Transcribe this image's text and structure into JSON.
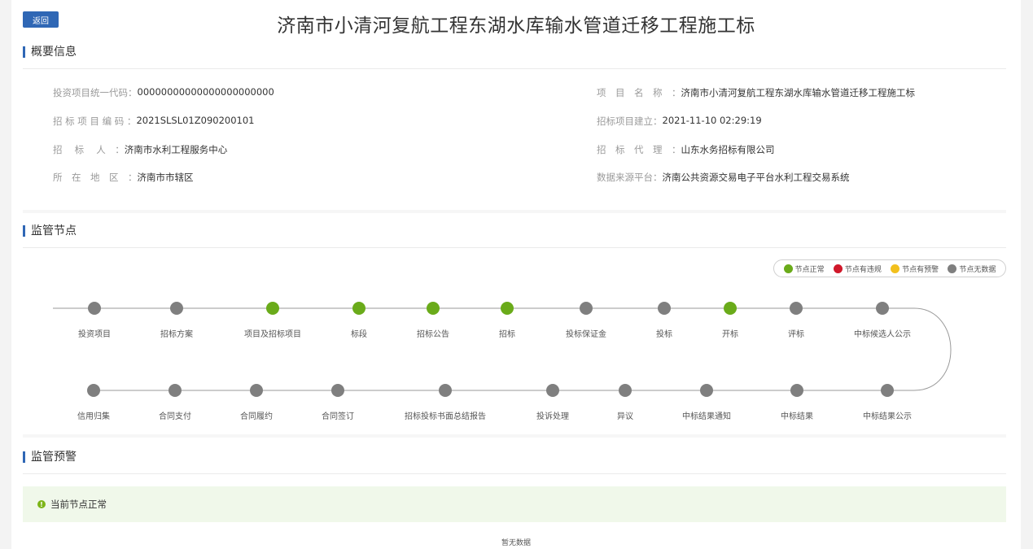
{
  "header": {
    "back_label": "返回",
    "title": "济南市小清河复航工程东湖水库输水管道迁移工程施工标"
  },
  "overview": {
    "title": "概要信息",
    "left": [
      {
        "label": "投资项目统一代码：",
        "value": "00000000000000000000000"
      },
      {
        "label": "招 标 项 目 编 码 ：",
        "value": "2021SLSL01Z090200101"
      },
      {
        "label": "招　 标　 人　：",
        "value": "济南市水利工程服务中心"
      },
      {
        "label": "所　在　地　区　：",
        "value": "济南市市辖区"
      }
    ],
    "right": [
      {
        "label": "项　目　名　称　：",
        "value": "济南市小清河复航工程东湖水库输水管道迁移工程施工标"
      },
      {
        "label": "招标项目建立：",
        "value": "2021-11-10 02:29:19"
      },
      {
        "label": "招　标　代　理　：",
        "value": "山东水务招标有限公司"
      },
      {
        "label": "数据来源平台：",
        "value": "济南公共资源交易电子平台水利工程交易系统"
      }
    ]
  },
  "nodes_section": {
    "title": "监管节点",
    "legend": [
      {
        "label": "节点正常",
        "color": "#6aab1a"
      },
      {
        "label": "节点有违规",
        "color": "#d0182a"
      },
      {
        "label": "节点有预警",
        "color": "#f2c01d"
      },
      {
        "label": "节点无数据",
        "color": "#7f7f7f"
      }
    ],
    "row1": [
      {
        "label": "投资项目",
        "status": "none"
      },
      {
        "label": "招标方案",
        "status": "none"
      },
      {
        "label": "项目及招标项目",
        "status": "normal"
      },
      {
        "label": "标段",
        "status": "normal"
      },
      {
        "label": "招标公告",
        "status": "normal"
      },
      {
        "label": "招标",
        "status": "normal"
      },
      {
        "label": "投标保证金",
        "status": "none"
      },
      {
        "label": "投标",
        "status": "none"
      },
      {
        "label": "开标",
        "status": "normal"
      },
      {
        "label": "评标",
        "status": "none"
      },
      {
        "label": "中标候选人公示",
        "status": "none"
      }
    ],
    "row2": [
      {
        "label": "信用归集",
        "status": "none"
      },
      {
        "label": "合同支付",
        "status": "none"
      },
      {
        "label": "合同履约",
        "status": "none"
      },
      {
        "label": "合同签订",
        "status": "none"
      },
      {
        "label": "招标投标书面总结报告",
        "status": "none"
      },
      {
        "label": "投诉处理",
        "status": "none"
      },
      {
        "label": "异议",
        "status": "none"
      },
      {
        "label": "中标结果通知",
        "status": "none"
      },
      {
        "label": "中标结果",
        "status": "none"
      },
      {
        "label": "中标结果公示",
        "status": "none"
      }
    ]
  },
  "warning_section": {
    "title": "监管预警",
    "alert_text": "当前节点正常",
    "empty_text": "暂无数据"
  }
}
